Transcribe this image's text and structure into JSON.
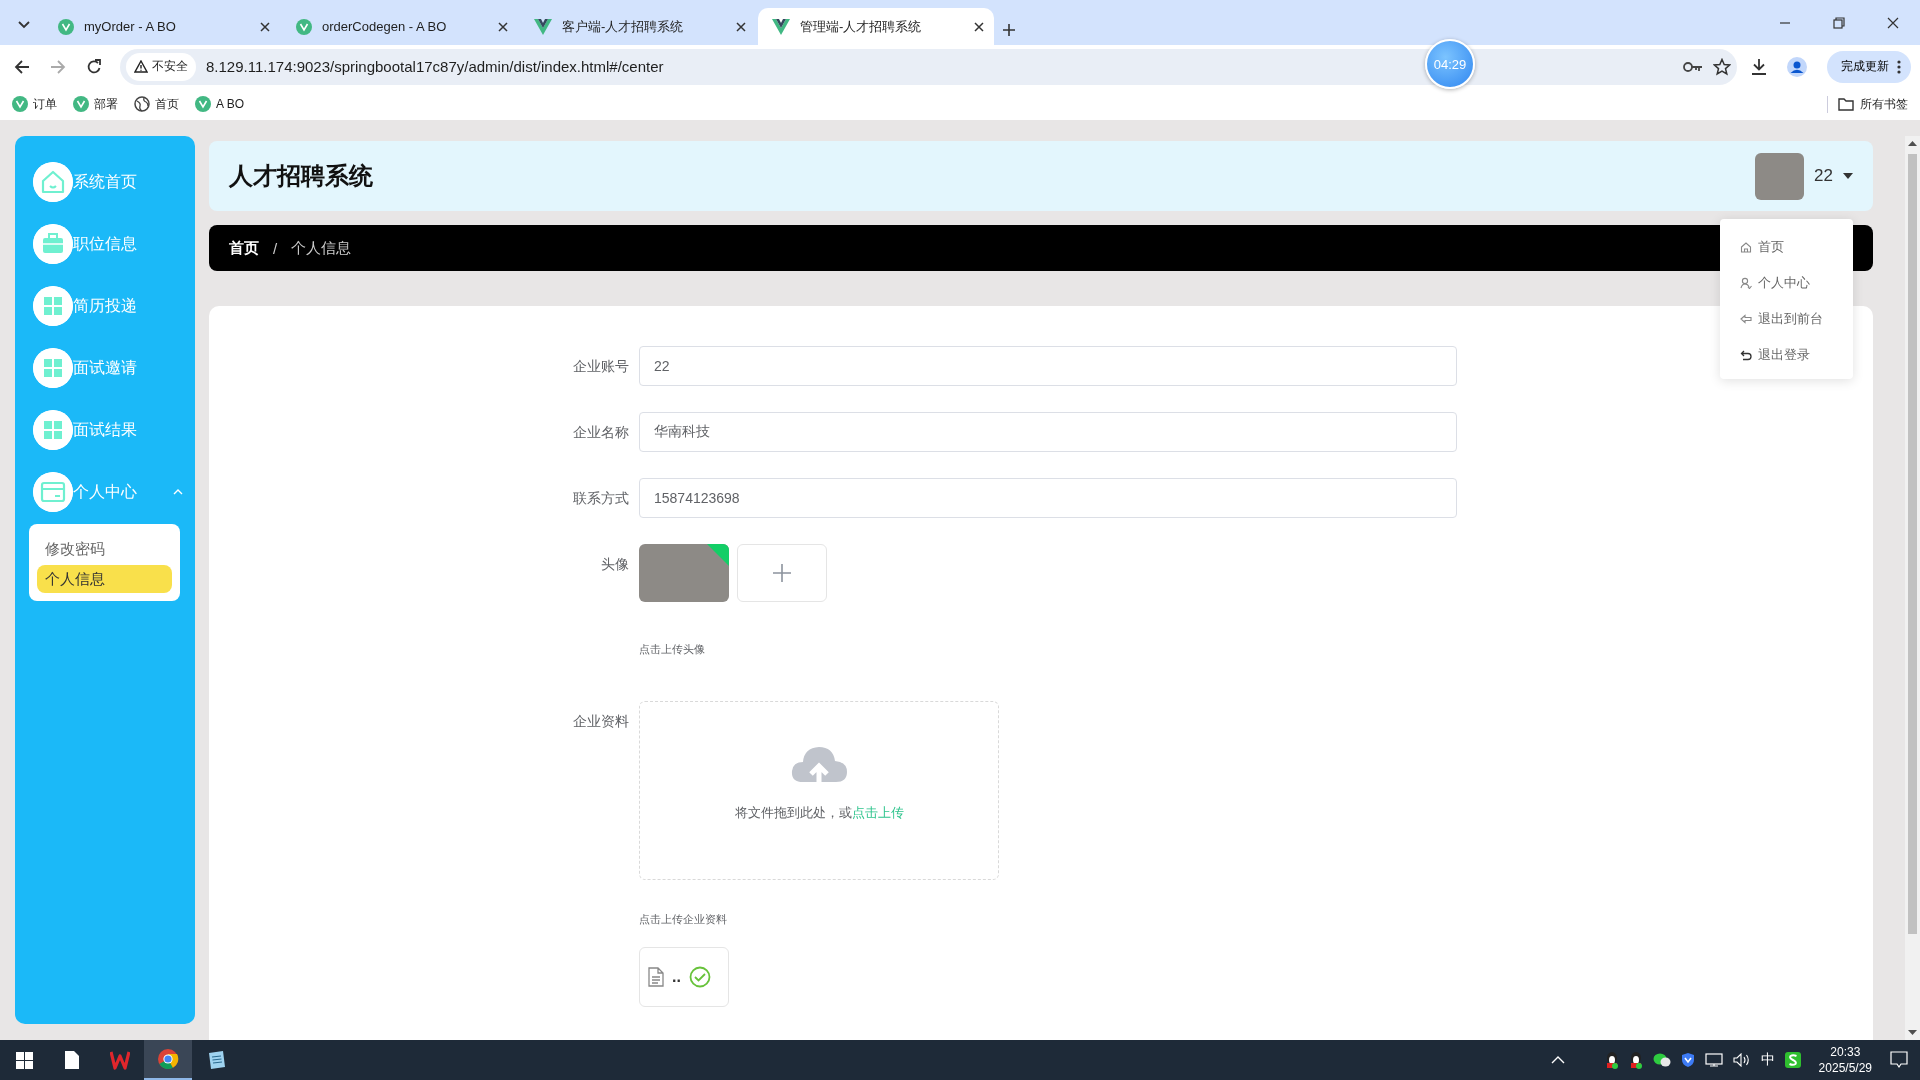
{
  "browser": {
    "tabs": [
      {
        "title": "myOrder - A BO",
        "selected": false,
        "kind": "dot"
      },
      {
        "title": "orderCodegen - A BO",
        "selected": false,
        "kind": "dot"
      },
      {
        "title": "客户端-人才招聘系统",
        "selected": false,
        "kind": "vue"
      },
      {
        "title": "管理端-人才招聘系统",
        "selected": true,
        "kind": "vue"
      }
    ],
    "security_label": "不安全",
    "url": "8.129.11.174:9023/springbootal17c87y/admin/dist/index.html#/center",
    "timer": "04:29",
    "update_button": "完成更新",
    "bookmarks": [
      {
        "label": "订单",
        "kind": "dot"
      },
      {
        "label": "部署",
        "kind": "dot"
      },
      {
        "label": "首页",
        "kind": "globe"
      },
      {
        "label": "A BO",
        "kind": "dot"
      }
    ],
    "all_bookmarks": "所有书签"
  },
  "sidebar": {
    "items": [
      {
        "label": "系统首页"
      },
      {
        "label": "职位信息"
      },
      {
        "label": "简历投递"
      },
      {
        "label": "面试邀请"
      },
      {
        "label": "面试结果"
      },
      {
        "label": "个人中心",
        "expanded": true,
        "children": [
          {
            "label": "修改密码",
            "selected": false
          },
          {
            "label": "个人信息",
            "selected": true
          }
        ]
      }
    ]
  },
  "header": {
    "title": "人才招聘系统",
    "user_name": "22"
  },
  "user_menu": {
    "items": [
      {
        "label": "首页"
      },
      {
        "label": "个人中心"
      },
      {
        "label": "退出到前台"
      },
      {
        "label": "退出登录"
      }
    ]
  },
  "breadcrumb": {
    "separator": "/",
    "items": [
      {
        "label": "首页"
      },
      {
        "label": "个人信息"
      }
    ]
  },
  "form": {
    "fields": [
      {
        "kind": "text",
        "label": "企业账号",
        "value": "22"
      },
      {
        "kind": "text",
        "label": "企业名称",
        "value": "华南科技"
      },
      {
        "kind": "text",
        "label": "联系方式",
        "value": "15874123698"
      },
      {
        "kind": "image",
        "label": "头像",
        "hint": "点击上传头像"
      },
      {
        "kind": "file",
        "label": "企业资料",
        "drop_text": "将文件拖到此处，或",
        "drop_link": "点击上传",
        "hint": "点击上传企业资料",
        "file_name": ".."
      }
    ]
  },
  "taskbar": {
    "ime": "中",
    "time": "20:33",
    "date": "2025/5/29"
  }
}
